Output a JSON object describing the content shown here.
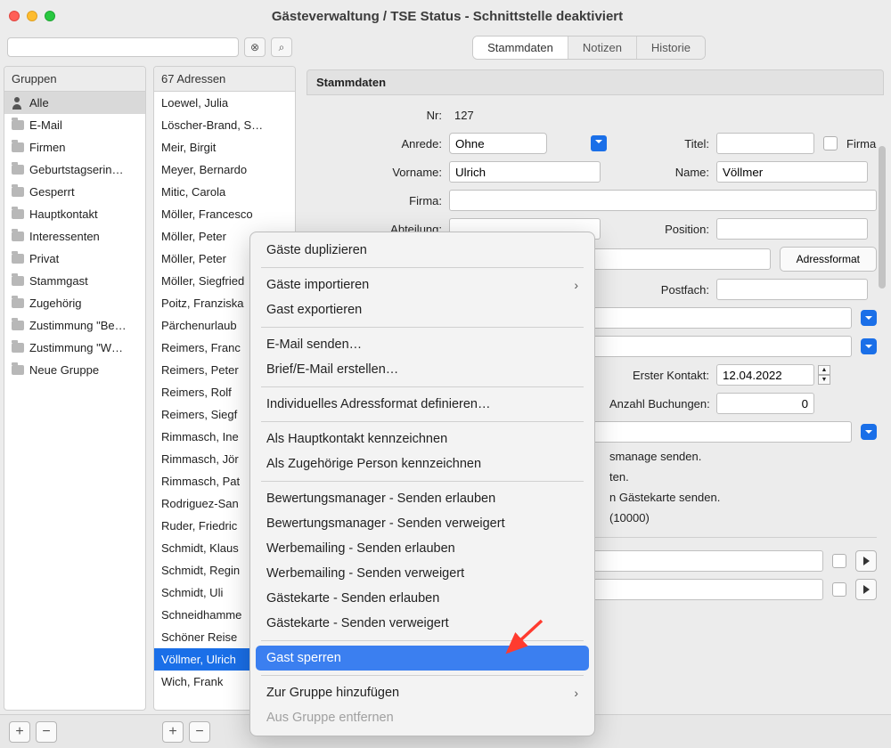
{
  "window": {
    "title": "Gästeverwaltung / TSE Status - Schnittstelle deaktiviert"
  },
  "toolbar": {
    "clear_icon": "⊗",
    "search_icon": "⌕"
  },
  "tabs": {
    "stammdaten": "Stammdaten",
    "notizen": "Notizen",
    "historie": "Historie"
  },
  "groups": {
    "header": "Gruppen",
    "items": [
      {
        "label": "Alle",
        "icon": "person",
        "selected": true
      },
      {
        "label": "E-Mail"
      },
      {
        "label": "Firmen"
      },
      {
        "label": "Geburtstagserin…"
      },
      {
        "label": "Gesperrt"
      },
      {
        "label": "Hauptkontakt"
      },
      {
        "label": "Interessenten"
      },
      {
        "label": "Privat"
      },
      {
        "label": "Stammgast"
      },
      {
        "label": "Zugehörig"
      },
      {
        "label": "Zustimmung \"Be…"
      },
      {
        "label": "Zustimmung \"W…"
      },
      {
        "label": "Neue Gruppe"
      }
    ]
  },
  "addresses": {
    "header": "67 Adressen",
    "items": [
      "Loewel, Julia",
      "Löscher-Brand, S…",
      "Meir, Birgit",
      "Meyer, Bernardo",
      "Mitic, Carola",
      "Möller, Francesco",
      "Möller, Peter",
      "Möller, Peter",
      "Möller, Siegfried",
      "Poitz, Franziska",
      "Pärchenurlaub",
      "Reimers, Franc",
      "Reimers, Peter",
      "Reimers, Rolf",
      "Reimers, Siegf",
      "Rimmasch, Ine",
      "Rimmasch, Jör",
      "Rimmasch, Pat",
      "Rodriguez-San",
      "Ruder, Friedric",
      "Schmidt, Klaus",
      "Schmidt, Regin",
      "Schmidt, Uli",
      "Schneidhamme",
      "Schöner Reise",
      "Völlmer, Ulrich",
      "Wich, Frank"
    ],
    "selected_index": 25
  },
  "detail": {
    "section": "Stammdaten",
    "fields": {
      "nr_label": "Nr:",
      "nr_value": "127",
      "anrede_label": "Anrede:",
      "anrede_value": "Ohne",
      "titel_label": "Titel:",
      "firma_chk_label": "Firma",
      "vorname_label": "Vorname:",
      "vorname_value": "Ulrich",
      "name_label": "Name:",
      "name_value": "Völlmer",
      "firma_label": "Firma:",
      "abteilung_label": "Abteilung:",
      "position_label": "Position:",
      "adressformat_btn": "Adressformat",
      "postfach_label": "Postfach:",
      "erster_kontakt_label": "Erster Kontakt:",
      "erster_kontakt_value": "12.04.2022",
      "anzahl_buch_label": "Anzahl Buchungen:",
      "anzahl_buch_value": "0",
      "text1": "smanage senden.",
      "text2": "ten.",
      "text3": "n Gästekarte senden.",
      "text4": "(10000)"
    }
  },
  "context_menu": {
    "items": [
      {
        "label": "Gäste duplizieren"
      },
      {
        "sep": true
      },
      {
        "label": "Gäste importieren",
        "sub": true
      },
      {
        "label": "Gast exportieren"
      },
      {
        "sep": true
      },
      {
        "label": "E-Mail senden…"
      },
      {
        "label": "Brief/E-Mail erstellen…"
      },
      {
        "sep": true
      },
      {
        "label": "Individuelles Adressformat definieren…"
      },
      {
        "sep": true
      },
      {
        "label": "Als Hauptkontakt kennzeichnen"
      },
      {
        "label": "Als Zugehörige Person kennzeichnen"
      },
      {
        "sep": true
      },
      {
        "label": "Bewertungsmanager - Senden erlauben"
      },
      {
        "label": "Bewertungsmanager - Senden verweigert"
      },
      {
        "label": "Werbemailing - Senden erlauben"
      },
      {
        "label": "Werbemailing - Senden verweigert"
      },
      {
        "label": "Gästekarte - Senden erlauben"
      },
      {
        "label": "Gästekarte - Senden verweigert"
      },
      {
        "sep": true
      },
      {
        "label": "Gast sperren",
        "highlight": true
      },
      {
        "sep": true
      },
      {
        "label": "Zur Gruppe hinzufügen",
        "sub": true
      },
      {
        "label": "Aus Gruppe entfernen",
        "disabled": true
      }
    ]
  },
  "bottombar": {
    "plus": "+",
    "minus": "−"
  }
}
